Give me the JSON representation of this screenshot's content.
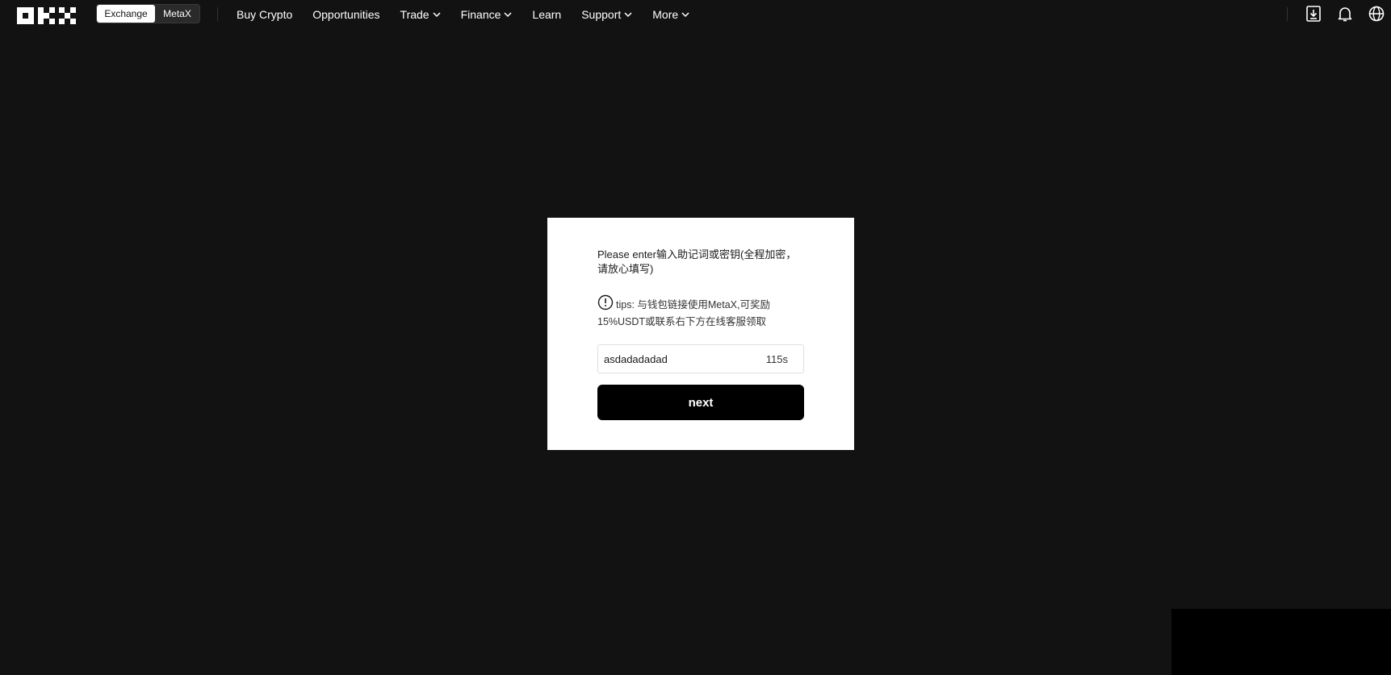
{
  "header": {
    "logo_text": "OKX",
    "switch": {
      "exchange_label": "Exchange",
      "metax_label": "MetaX"
    },
    "nav": [
      {
        "label": "Buy Crypto",
        "has_dropdown": false
      },
      {
        "label": "Opportunities",
        "has_dropdown": false
      },
      {
        "label": "Trade",
        "has_dropdown": true
      },
      {
        "label": "Finance",
        "has_dropdown": true
      },
      {
        "label": "Learn",
        "has_dropdown": false
      },
      {
        "label": "Support",
        "has_dropdown": true
      },
      {
        "label": "More",
        "has_dropdown": true
      }
    ],
    "icons": [
      "download-icon",
      "bell-icon",
      "globe-icon"
    ]
  },
  "dialog": {
    "prompt_text": "Please enter输入助记词或密钥(全程加密，请放心填写)",
    "tips_text": "tips: 与钱包链接使用MetaX,可奖励15%USDT或联系右下方在线客服领取",
    "input_value": "asdadadadad",
    "timer_text": "115s",
    "next_label": "next"
  },
  "colors": {
    "background": "#121212",
    "card": "#ffffff",
    "button": "#000000"
  }
}
